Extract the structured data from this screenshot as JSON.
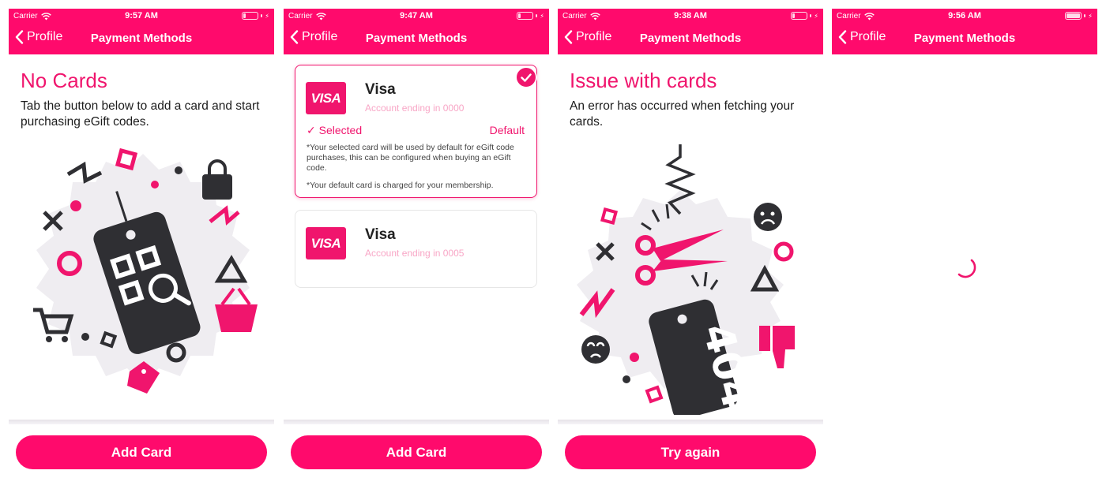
{
  "colors": {
    "accent": "#ff0a6c",
    "text": "#1c1c1c",
    "muted_pink": "#f8a6c6"
  },
  "screens": [
    {
      "status": {
        "carrier": "Carrier",
        "time": "9:57 AM"
      },
      "nav": {
        "back_label": "Profile",
        "title": "Payment Methods"
      },
      "heading": "No Cards",
      "description": "Tab the button below to add a card and start purchasing eGift codes.",
      "illustration": "qr-code-tag-illustration",
      "button": "Add Card"
    },
    {
      "status": {
        "carrier": "Carrier",
        "time": "9:47 AM"
      },
      "nav": {
        "back_label": "Profile",
        "title": "Payment Methods"
      },
      "cards": [
        {
          "logo": "VISA",
          "name": "Visa",
          "subtitle": "Account ending in 0000",
          "selected_label": "✓ Selected",
          "default_label": "Default",
          "note1": "*Your selected card will be used by default for eGift code purchases, this can be configured when buying an eGift code.",
          "note2": "*Your default card is charged for your membership.",
          "selected": true
        },
        {
          "logo": "VISA",
          "name": "Visa",
          "subtitle": "Account ending in 0005",
          "selected": false
        }
      ],
      "button": "Add Card"
    },
    {
      "status": {
        "carrier": "Carrier",
        "time": "9:38 AM"
      },
      "nav": {
        "back_label": "Profile",
        "title": "Payment Methods"
      },
      "heading": "Issue with cards",
      "description": "An error has occurred when fetching your cards.",
      "illustration": "404-error-tag-illustration",
      "tag_text": "404",
      "button": "Try again"
    },
    {
      "status": {
        "carrier": "Carrier",
        "time": "9:56 AM"
      },
      "nav": {
        "back_label": "Profile",
        "title": "Payment Methods"
      },
      "state": "loading-spinner"
    }
  ]
}
